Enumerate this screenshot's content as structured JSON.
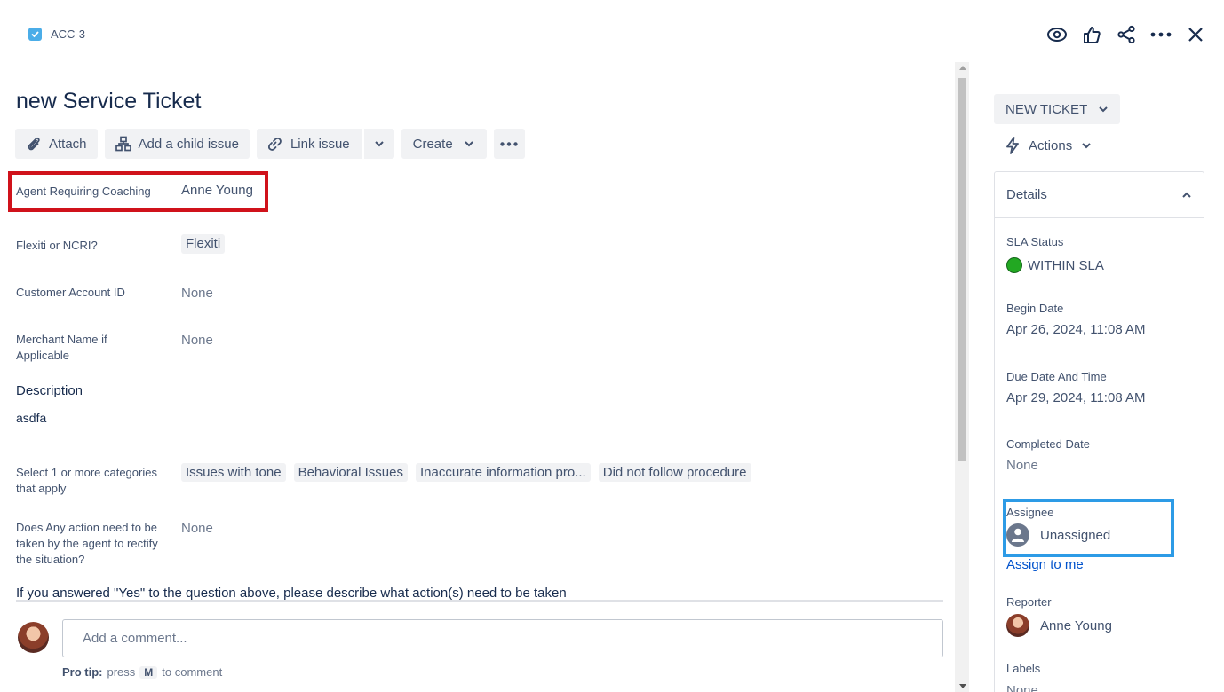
{
  "header": {
    "issue_key": "ACC-3"
  },
  "issue": {
    "title": "new Service Ticket"
  },
  "toolbar": {
    "attach_label": "Attach",
    "add_child_label": "Add a child issue",
    "link_issue_label": "Link issue",
    "create_label": "Create"
  },
  "fields": {
    "agent_coaching": {
      "label": "Agent Requiring Coaching",
      "value": "Anne Young"
    },
    "flexiti_ncri": {
      "label": "Flexiti or NCRI?",
      "value": "Flexiti"
    },
    "customer_account": {
      "label": "Customer Account ID",
      "value": "None"
    },
    "merchant_name": {
      "label": "Merchant Name if Applicable",
      "value": "None"
    },
    "description": {
      "heading": "Description",
      "value": "asdfa"
    },
    "categories": {
      "label": "Select 1 or more categories that apply",
      "tags": [
        "Issues with tone",
        "Behavioral Issues",
        "Inaccurate information pro...",
        "Did not follow procedure"
      ]
    },
    "action_needed": {
      "label": "Does Any action need to be taken by the agent to rectify the situation?",
      "value": "None"
    },
    "question_text": "If you answered \"Yes\" to the question above, please describe what action(s) need to be taken"
  },
  "comment": {
    "placeholder": "Add a comment...",
    "pro_tip_prefix": "Pro tip:",
    "pro_tip_press": "press",
    "pro_tip_key": "M",
    "pro_tip_suffix": "to comment"
  },
  "sidebar": {
    "status_label": "NEW TICKET",
    "actions_label": "Actions",
    "details_heading": "Details",
    "sla_status": {
      "label": "SLA Status",
      "value": "WITHIN SLA",
      "color": "#22a822"
    },
    "begin_date": {
      "label": "Begin Date",
      "value": "Apr 26, 2024, 11:08 AM"
    },
    "due_date": {
      "label": "Due Date And Time",
      "value": "Apr 29, 2024, 11:08 AM"
    },
    "completed_date": {
      "label": "Completed Date",
      "value": "None"
    },
    "assignee": {
      "label": "Assignee",
      "value": "Unassigned",
      "assign_link": "Assign to me"
    },
    "reporter": {
      "label": "Reporter",
      "value": "Anne Young"
    },
    "labels": {
      "label": "Labels",
      "value": "None"
    }
  },
  "colors": {
    "highlight_red": "#d0121b",
    "highlight_blue": "#2d9be6",
    "link": "#0052cc"
  }
}
